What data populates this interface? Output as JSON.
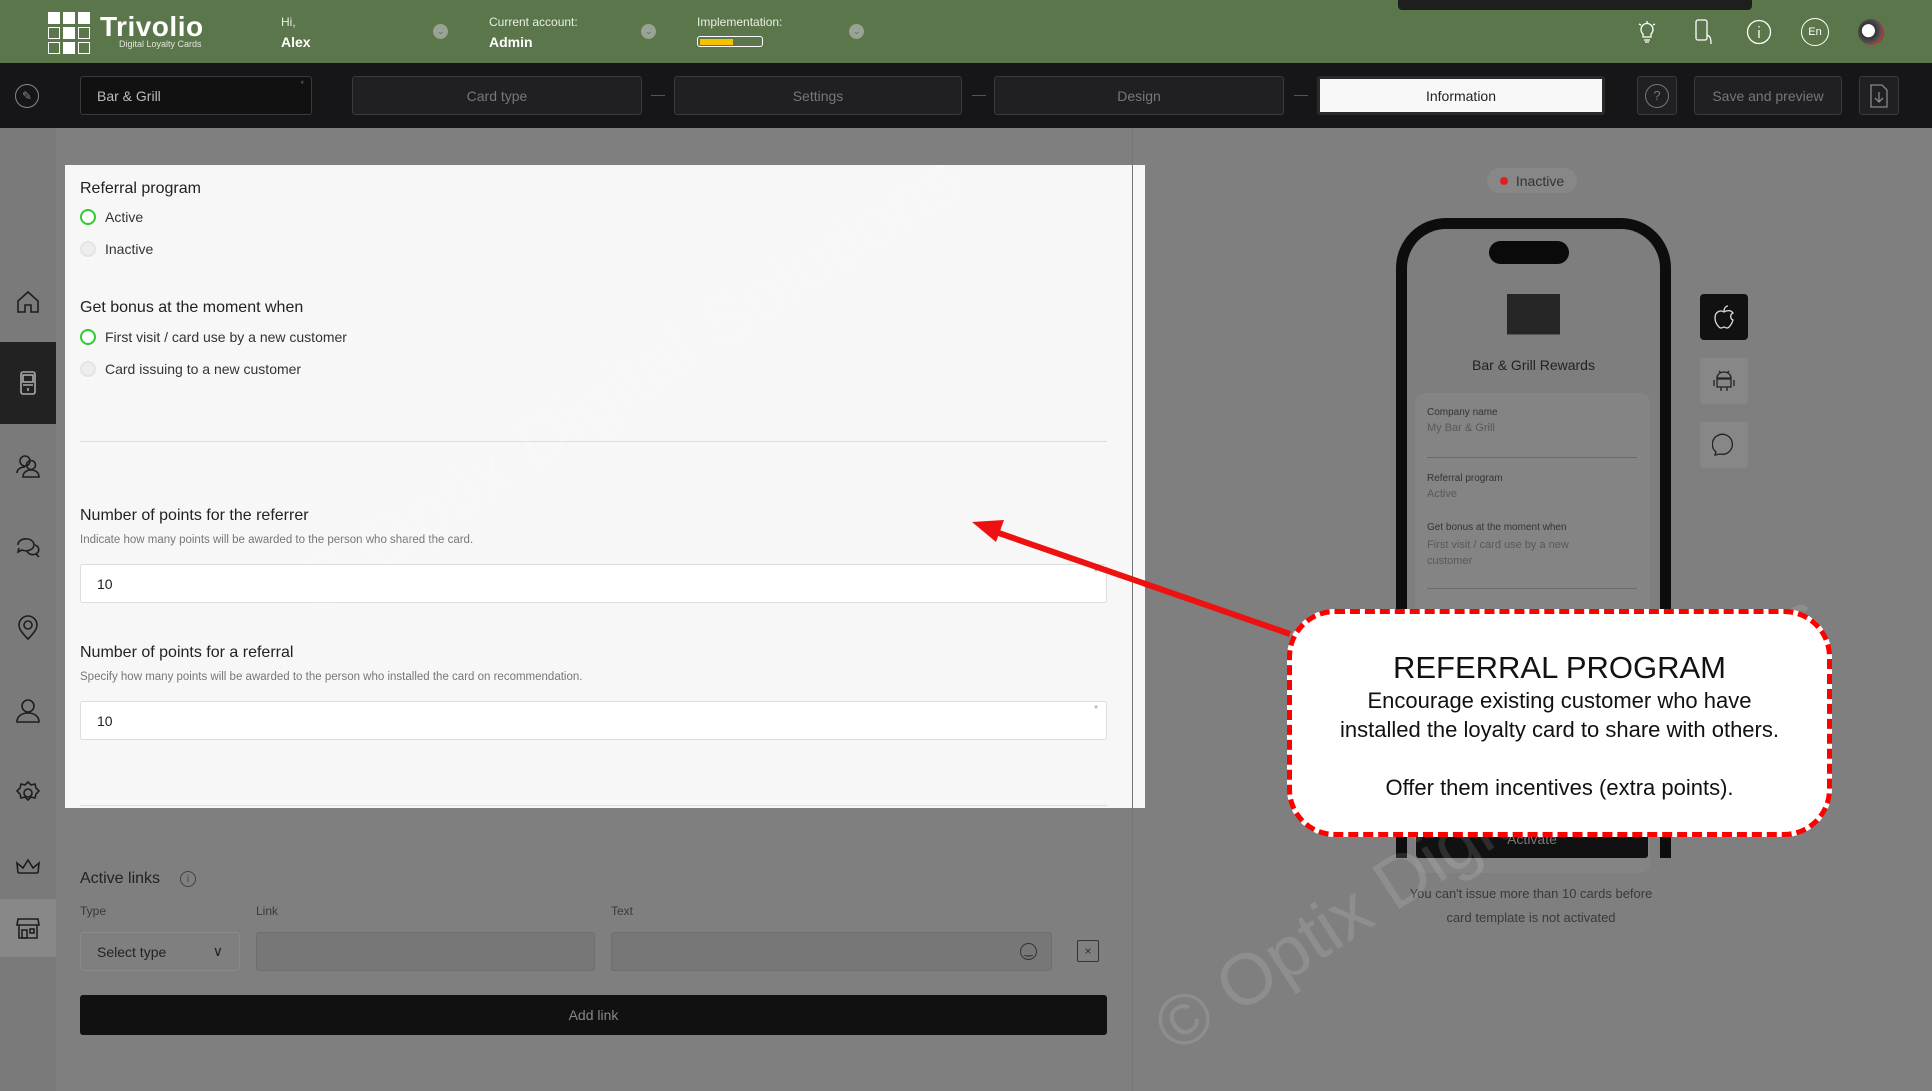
{
  "header": {
    "logo_name": "Trivolio",
    "logo_tagline": "Digital Loyalty Cards",
    "greeting_label": "Hi,",
    "user_name": "Alex",
    "account_label": "Current account:",
    "account_value": "Admin",
    "implementation_label": "Implementation:",
    "implementation_progress": 0.55,
    "icons": [
      "lightbulb-icon",
      "phone-icon",
      "info-icon",
      "language-icon",
      "avatar"
    ],
    "language": "En"
  },
  "toolbar": {
    "card_name": "Bar & Grill",
    "steps": [
      "Card type",
      "Settings",
      "Design",
      "Information"
    ],
    "active_step": "Information",
    "save_label": "Save and preview"
  },
  "sidebar": {
    "items": [
      "home-icon",
      "card-icon",
      "customers-icon",
      "messages-icon",
      "location-icon",
      "user-icon",
      "settings-icon",
      "crown-icon",
      "store-icon"
    ],
    "active": "card-icon"
  },
  "form": {
    "referral_title": "Referral program",
    "referral_options": [
      "Active",
      "Inactive"
    ],
    "referral_selected": "Active",
    "bonus_title": "Get bonus at the moment when",
    "bonus_options": [
      "First visit / card use by a new customer",
      "Card issuing to a new customer"
    ],
    "bonus_selected": "First visit / card use by a new customer",
    "referrer_title": "Number of points for the referrer",
    "referrer_desc": "Indicate how many points will be awarded to the person who shared the card.",
    "referrer_value": "10",
    "referral_points_title": "Number of points for a referral",
    "referral_points_desc": "Specify how many points will be awarded to the person who installed the card on recommendation.",
    "referral_points_value": "10",
    "required_mark": "*"
  },
  "links": {
    "title": "Active links",
    "type_label": "Type",
    "link_label": "Link",
    "text_label": "Text",
    "type_placeholder": "Select type",
    "add_label": "Add link"
  },
  "preview": {
    "status": "Inactive",
    "status_color": "#e02020",
    "card_title": "Bar & Grill Rewards",
    "fields": [
      {
        "label": "Company name",
        "value": "My Bar & Grill"
      },
      {
        "label": "Referral program",
        "value": "Active"
      },
      {
        "label": "Get bonus at the moment when",
        "value": "First visit / card use by a new customer"
      }
    ],
    "activate_label": "Activate",
    "notice_line1": "You can't issue more than 10 cards before",
    "notice_line2": "card template is not activated",
    "platforms": [
      "apple-icon",
      "android-icon",
      "chat-icon"
    ]
  },
  "callout": {
    "title": "REFERRAL PROGRAM",
    "line1": "Encourage existing customer who have",
    "line2": "installed the loyalty card to share with others.",
    "line3": "Offer them incentives (extra points).",
    "border_color": "#ff0000"
  },
  "watermark": "© Optix Digital Solutions"
}
